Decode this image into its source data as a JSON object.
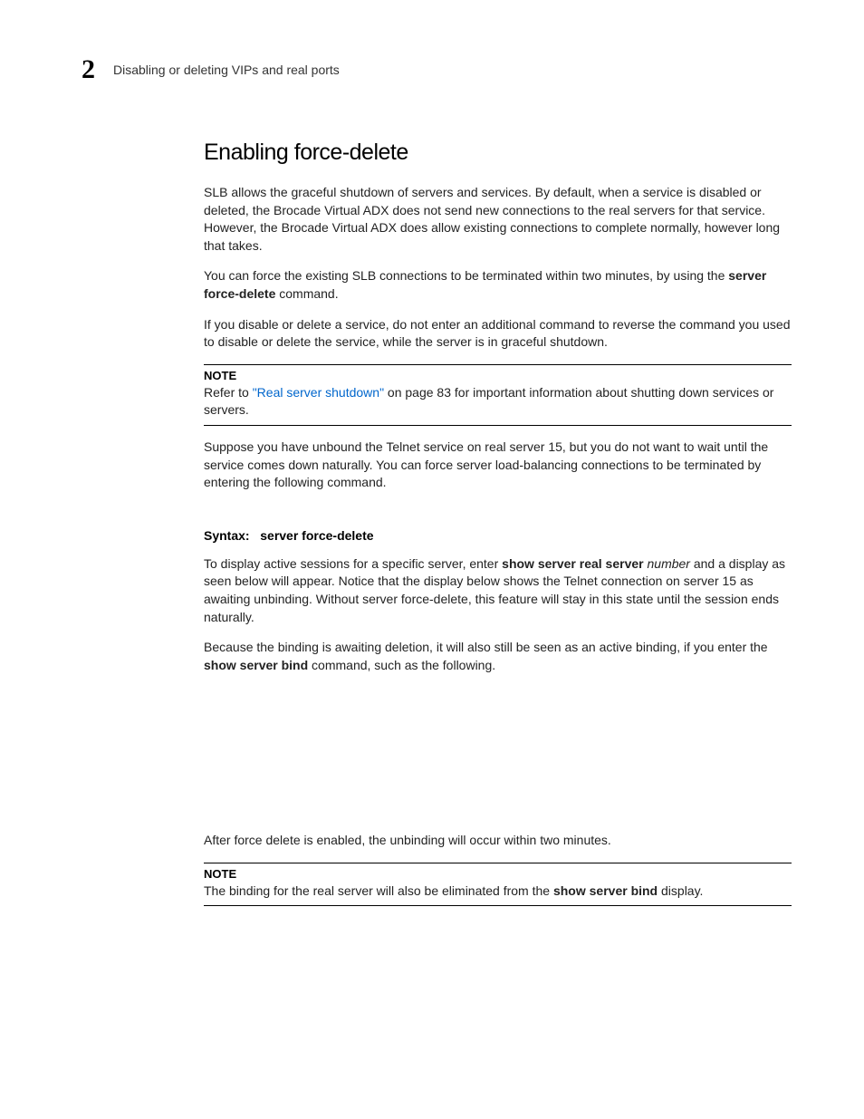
{
  "header": {
    "chapter_number": "2",
    "title": "Disabling or deleting VIPs and real ports"
  },
  "heading": "Enabling force-delete",
  "para1": "SLB allows the graceful shutdown of servers and services. By default, when a service is disabled or deleted, the Brocade Virtual ADX does not send new connections to the real servers for that service. However, the Brocade Virtual ADX does allow existing connections to complete normally, however long that takes.",
  "para2_pre": "You can force the existing SLB connections to be terminated within two minutes, by using the ",
  "para2_bold": "server force-delete",
  "para2_post": " command.",
  "para3": "If you disable or delete a service, do not enter an additional command to reverse the command you used to disable or delete the service, while the server is in graceful shutdown.",
  "note1": {
    "label": "NOTE",
    "pre": "Refer to ",
    "link": "\"Real server shutdown\"",
    "post": " on page 83 for important information about shutting down services or servers."
  },
  "para4": "Suppose you have unbound the Telnet service on real server 15, but you do not want to wait until the service comes down naturally. You can force server load-balancing connections to be terminated by entering the following command.",
  "syntax": {
    "label": "Syntax:",
    "cmd": "server force-delete"
  },
  "para5_pre": "To display active sessions for a specific server, enter ",
  "para5_bold1": "show server real server",
  "para5_italic": " number",
  "para5_post": " and a display as seen below will appear. Notice that the display below shows the Telnet connection on server 15 as awaiting unbinding. Without server force-delete, this feature will stay in this state until the session ends naturally.",
  "para6_pre": "Because the binding is awaiting deletion, it will also still be seen as an active binding, if you enter the ",
  "para6_bold": "show server bind",
  "para6_post": " command, such as the following.",
  "para7": "After force delete is enabled, the unbinding will occur within two minutes.",
  "note2": {
    "label": "NOTE",
    "pre": "The binding for the real server will also be eliminated from the ",
    "bold": "show server bind",
    "post": " display."
  }
}
